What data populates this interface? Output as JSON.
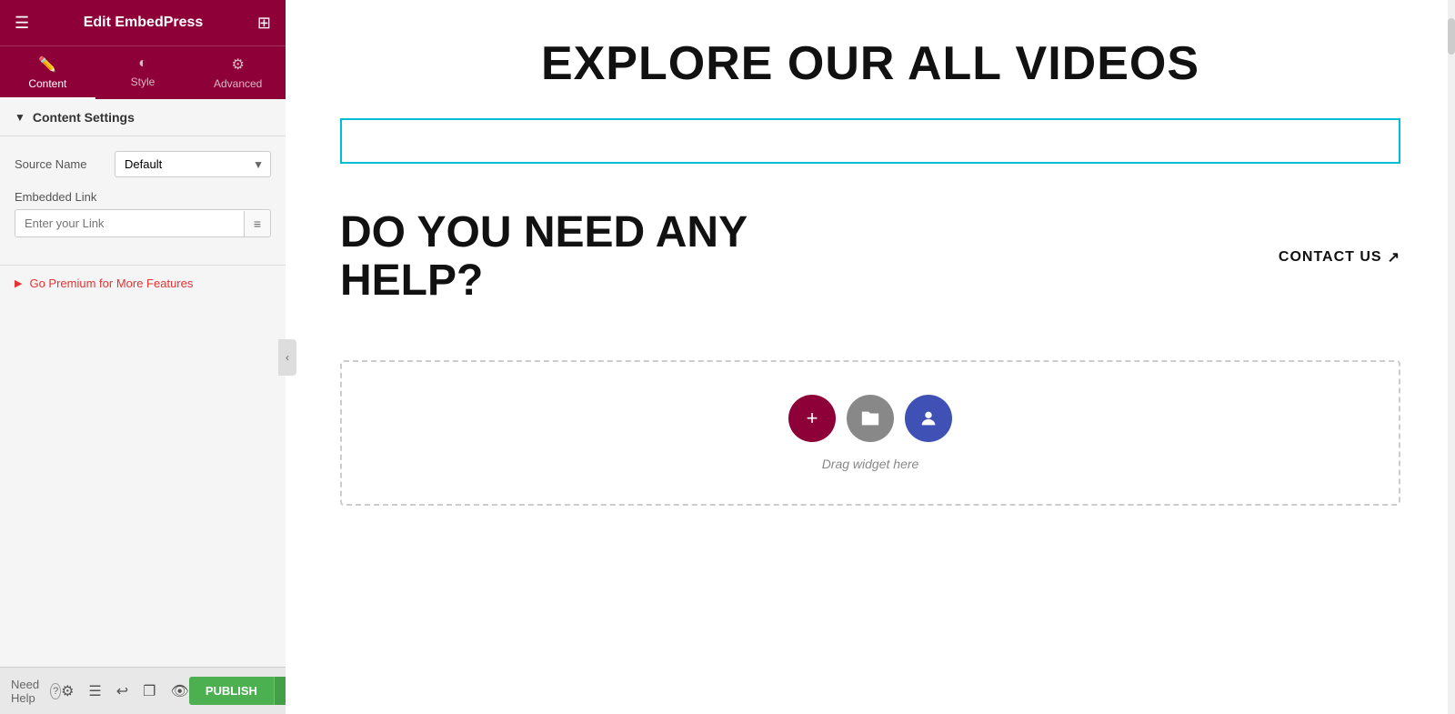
{
  "header": {
    "title": "Edit EmbedPress",
    "hamburger_icon": "☰",
    "grid_icon": "⊞"
  },
  "tabs": [
    {
      "id": "content",
      "label": "Content",
      "icon": "✏️",
      "active": true
    },
    {
      "id": "style",
      "label": "Style",
      "icon": "◐",
      "active": false
    },
    {
      "id": "advanced",
      "label": "Advanced",
      "icon": "⚙",
      "active": false
    }
  ],
  "sections": {
    "content_settings": {
      "label": "Content Settings",
      "expanded": true
    }
  },
  "form": {
    "source_name_label": "Source Name",
    "source_name_default": "Default",
    "embedded_link_label": "Embedded Link",
    "embedded_link_placeholder": "Enter your Link",
    "link_icon": "≡"
  },
  "premium": {
    "label": "Go Premium for More Features",
    "arrow": "▶"
  },
  "footer": {
    "need_help_label": "Need Help",
    "help_icon": "?",
    "collapse_icon": "‹"
  },
  "bottom_bar": {
    "icons": [
      "⚙",
      "☰",
      "↩",
      "❐",
      "👁"
    ],
    "publish_label": "PUBLISH",
    "dropdown_icon": "▼"
  },
  "main": {
    "explore_title": "EXPLORE OUR ALL VIDEOS",
    "help_heading_line1": "DO YOU NEED ANY",
    "help_heading_line2": "HELP?",
    "contact_us_label": "CONTACT US",
    "drag_widget_text": "Drag widget here"
  },
  "colors": {
    "header_bg": "#8e0038",
    "active_tab_underline": "#ffffff",
    "premium_text": "#e53333",
    "publish_btn": "#4caf50",
    "embed_border": "#00bcd4"
  }
}
